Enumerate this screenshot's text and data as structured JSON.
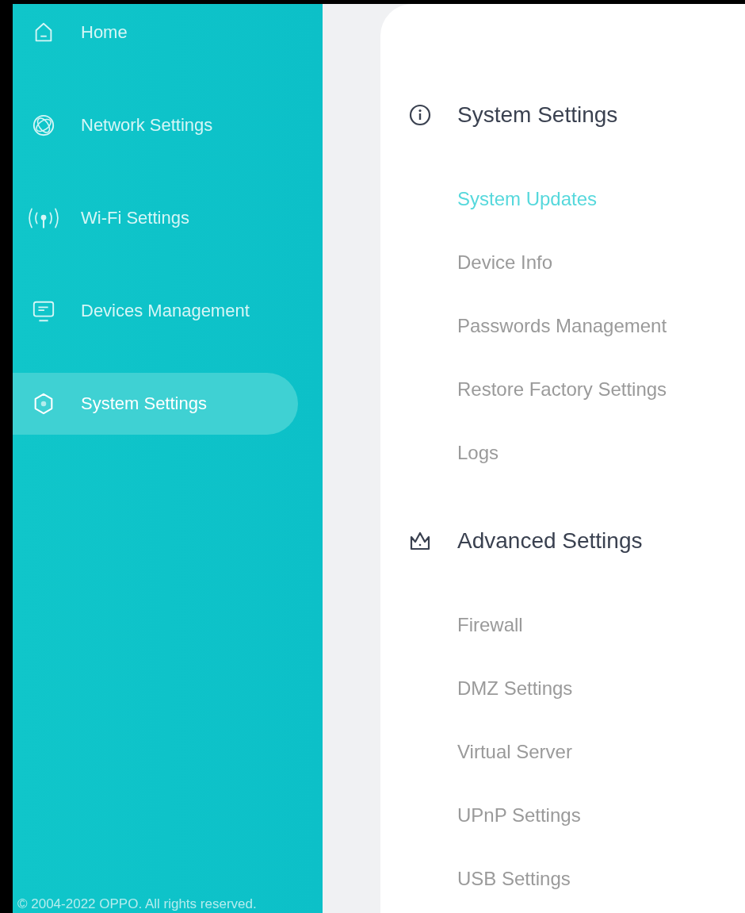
{
  "sidebar": {
    "items": [
      {
        "label": "Home",
        "selected": false
      },
      {
        "label": "Network Settings",
        "selected": false
      },
      {
        "label": "Wi-Fi Settings",
        "selected": false
      },
      {
        "label": "Devices Management",
        "selected": false
      },
      {
        "label": "System Settings",
        "selected": true
      }
    ],
    "footer": "© 2004-2022 OPPO. All rights reserved."
  },
  "sections": [
    {
      "title": "System Settings",
      "items": [
        {
          "label": "System Updates",
          "selected": true
        },
        {
          "label": "Device Info",
          "selected": false
        },
        {
          "label": "Passwords Management",
          "selected": false
        },
        {
          "label": "Restore Factory Settings",
          "selected": false
        },
        {
          "label": "Logs",
          "selected": false
        }
      ]
    },
    {
      "title": "Advanced Settings",
      "items": [
        {
          "label": "Firewall",
          "selected": false
        },
        {
          "label": "DMZ Settings",
          "selected": false
        },
        {
          "label": "Virtual Server",
          "selected": false
        },
        {
          "label": "UPnP Settings",
          "selected": false
        },
        {
          "label": "USB Settings",
          "selected": false
        }
      ]
    }
  ]
}
